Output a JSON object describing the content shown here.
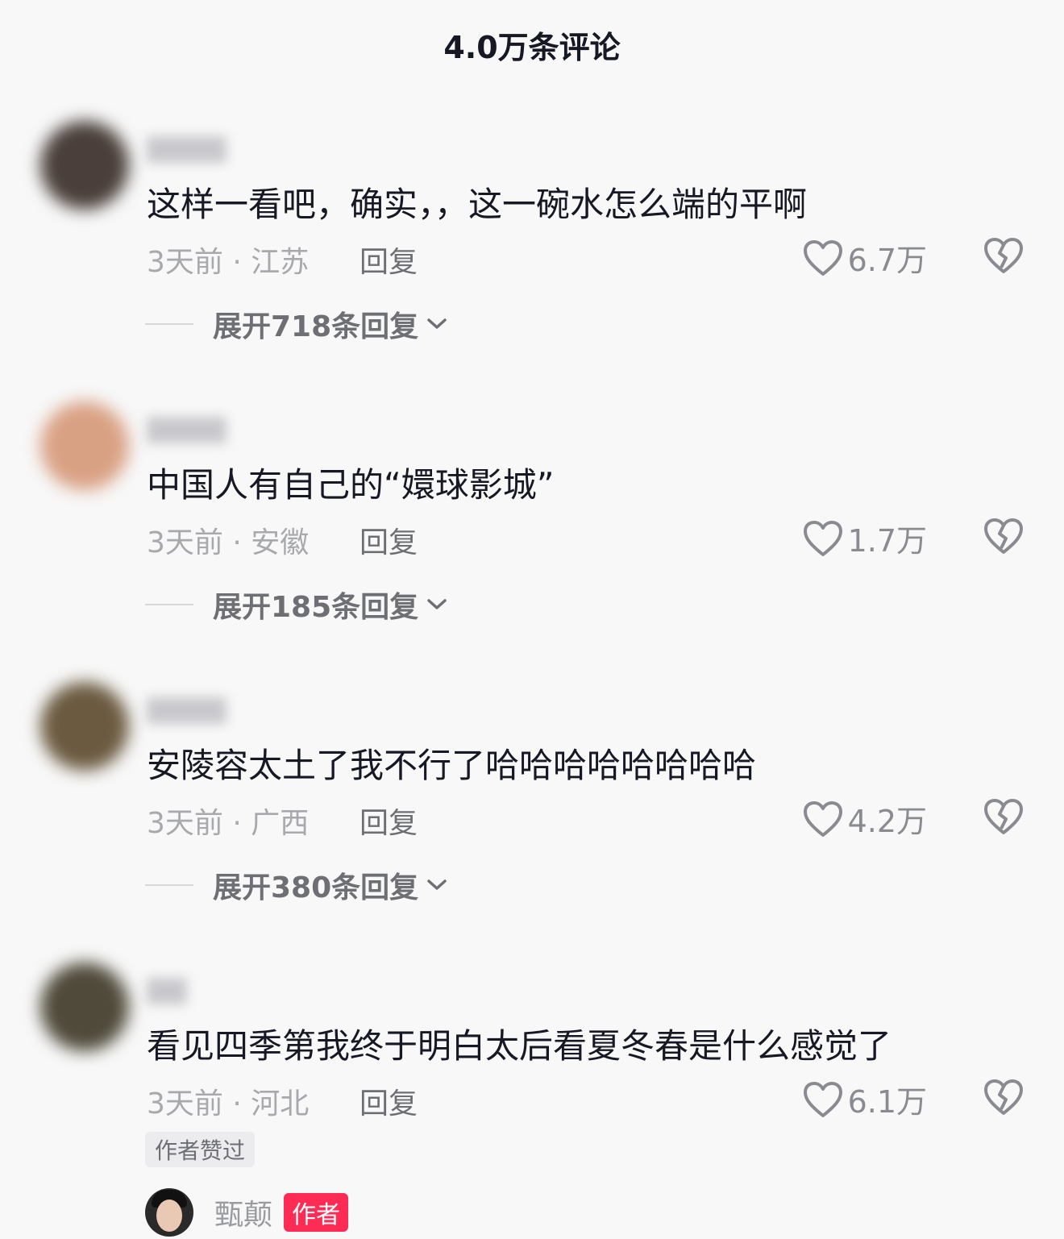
{
  "header": {
    "title": "4.0万条评论"
  },
  "comments": [
    {
      "text": "这样一看吧，确实，，这一碗水怎么端的平啊",
      "meta": "3天前 · 江苏",
      "reply_label": "回复",
      "likes": "6.7万",
      "expand": "展开718条回复",
      "avatar_color": "#4a3f3a"
    },
    {
      "text": "中国人有自己的“嬛球影城”",
      "meta": "3天前 · 安徽",
      "reply_label": "回复",
      "likes": "1.7万",
      "expand": "展开185条回复",
      "avatar_color": "#d9a184"
    },
    {
      "text": "安陵容太土了我不行了哈哈哈哈哈哈哈哈",
      "meta": "3天前 · 广西",
      "reply_label": "回复",
      "likes": "4.2万",
      "expand": "展开380条回复",
      "avatar_color": "#6b5a40"
    },
    {
      "text": "看见四季第我终于明白太后看夏冬春是什么感觉了",
      "meta": "3天前 · 河北",
      "reply_label": "回复",
      "likes": "6.1万",
      "badge": "作者赞过",
      "avatar_color": "#4f4a3a"
    }
  ],
  "author_reply": {
    "name": "甄颠",
    "tag": "作者"
  },
  "colors": {
    "accent": "#fe2c55",
    "text": "#161823",
    "muted": "#a8a9ad"
  }
}
